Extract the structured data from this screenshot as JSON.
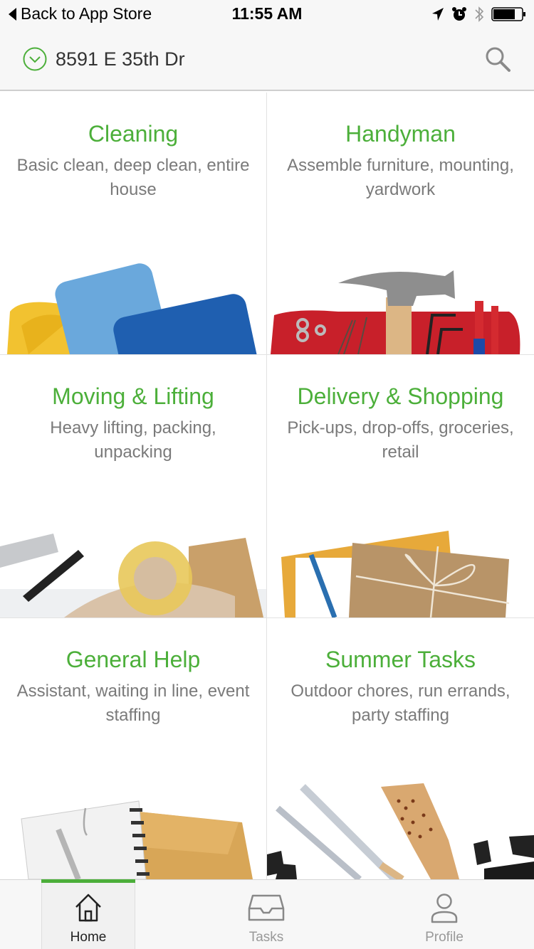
{
  "status_bar": {
    "back_label": "Back to App Store",
    "time": "11:55 AM",
    "icons": [
      "location-arrow-icon",
      "alarm-icon",
      "bluetooth-icon",
      "battery-icon"
    ]
  },
  "header": {
    "address": "8591 E 35th Dr",
    "address_icon": "chevron-down-circle-icon",
    "search_icon": "search-icon"
  },
  "colors": {
    "accent": "#4caf3a",
    "description": "#7a7a7a",
    "background": "#f7f7f7"
  },
  "categories": [
    {
      "title": "Cleaning",
      "description": "Basic clean, deep clean, entire house",
      "image": "sponges-and-cloth"
    },
    {
      "title": "Handyman",
      "description": "Assemble furniture, mounting, yardwork",
      "image": "hammer-and-tools"
    },
    {
      "title": "Moving & Lifting",
      "description": "Heavy lifting, packing, unpacking",
      "image": "tape-and-boxes"
    },
    {
      "title": "Delivery & Shopping",
      "description": "Pick-ups, drop-offs, groceries, retail",
      "image": "wrapped-package"
    },
    {
      "title": "General Help",
      "description": "Assistant, waiting in line, event staffing",
      "image": "planner-and-envelopes"
    },
    {
      "title": "Summer Tasks",
      "description": "Outdoor chores, run errands, party staffing",
      "image": "grill-tools"
    }
  ],
  "tabbar": {
    "tabs": [
      {
        "label": "Home",
        "icon": "home-icon",
        "active": true
      },
      {
        "label": "Tasks",
        "icon": "inbox-tray-icon",
        "active": false
      },
      {
        "label": "Profile",
        "icon": "person-icon",
        "active": false
      }
    ]
  }
}
